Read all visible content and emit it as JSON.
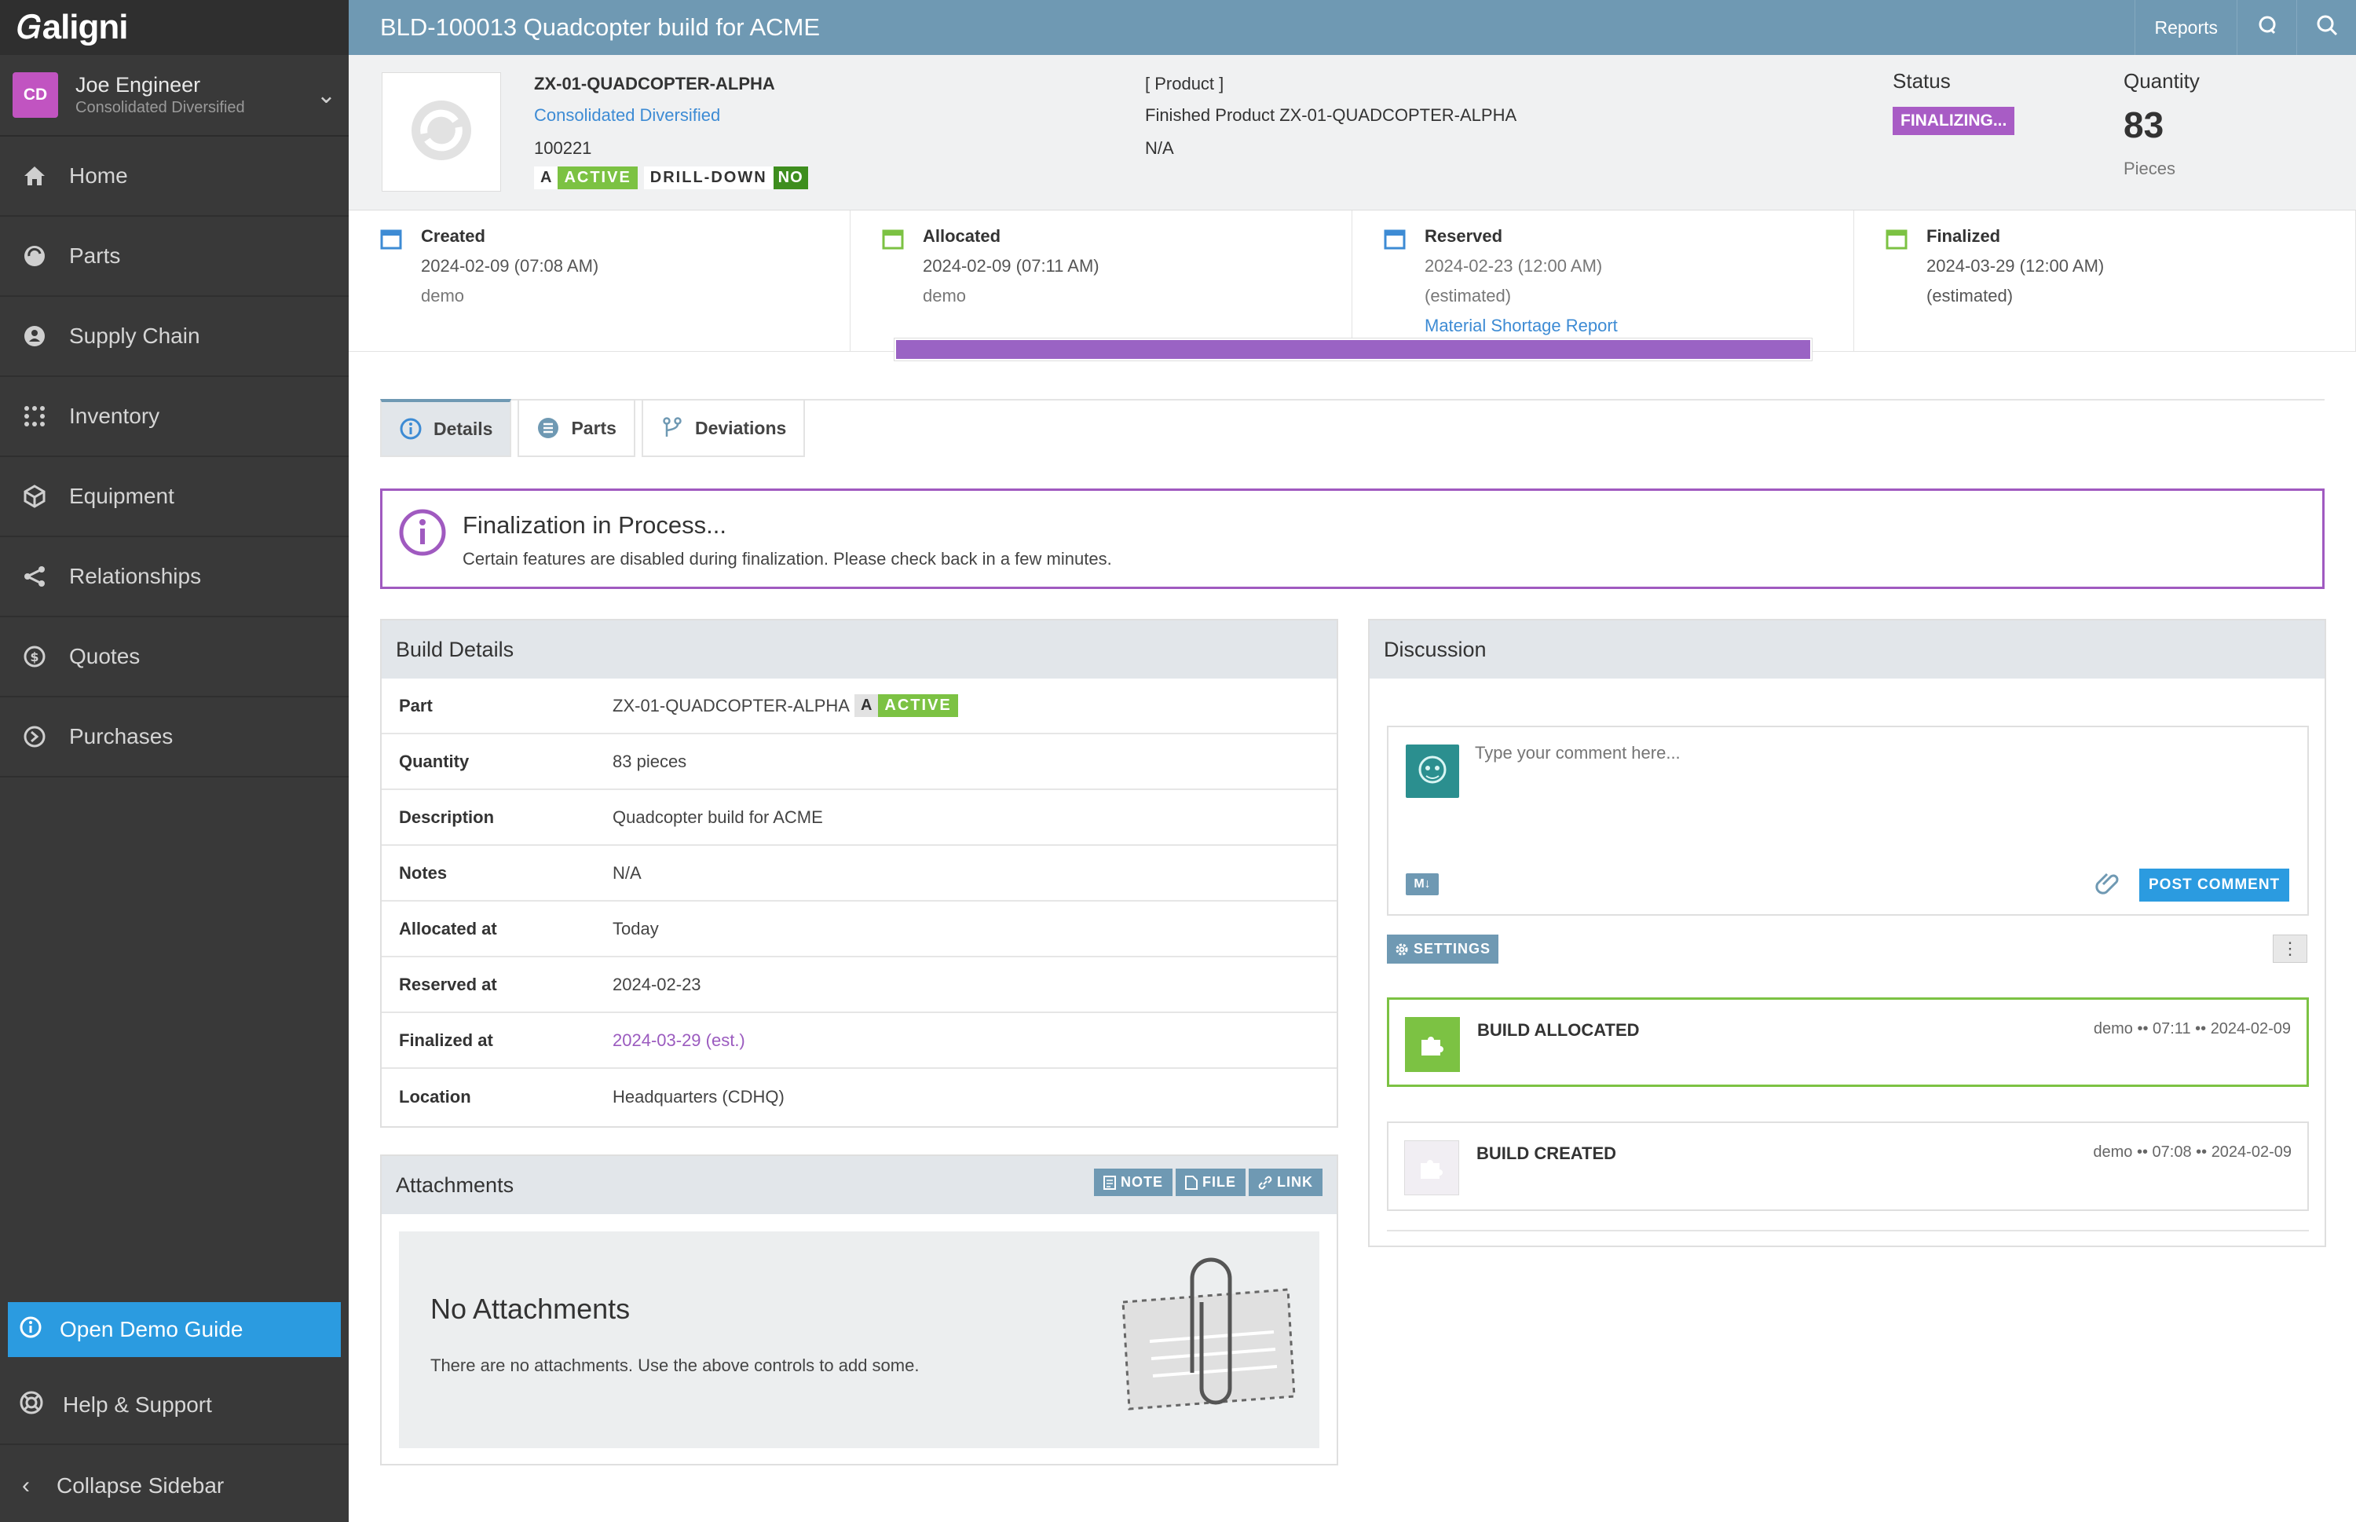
{
  "app": {
    "logo": "aligni"
  },
  "user": {
    "initials": "CD",
    "name": "Joe Engineer",
    "org": "Consolidated Diversified"
  },
  "nav": [
    {
      "label": "Home",
      "icon": "home-icon"
    },
    {
      "label": "Parts",
      "icon": "parts-icon"
    },
    {
      "label": "Supply Chain",
      "icon": "supply-chain-icon"
    },
    {
      "label": "Inventory",
      "icon": "inventory-icon"
    },
    {
      "label": "Equipment",
      "icon": "equipment-icon"
    },
    {
      "label": "Relationships",
      "icon": "relationships-icon"
    },
    {
      "label": "Quotes",
      "icon": "quotes-icon"
    },
    {
      "label": "Purchases",
      "icon": "purchases-icon"
    }
  ],
  "sidebar_bottom": {
    "demo_guide": "Open Demo Guide",
    "help": "Help & Support",
    "collapse": "Collapse Sidebar"
  },
  "header": {
    "title": "BLD-100013 Quadcopter build for ACME",
    "reports": "Reports"
  },
  "summary": {
    "part_number": "ZX-01-QUADCOPTER-ALPHA",
    "company": "Consolidated Diversified",
    "number": "100221",
    "rev": "A",
    "state": "ACTIVE",
    "drilldown_label": "DRILL-DOWN",
    "drilldown_value": "NO",
    "product_type": "[ Product ]",
    "product_desc": "Finished Product ZX-01-QUADCOPTER-ALPHA",
    "product_na": "N/A",
    "status_label": "Status",
    "status_value": "FINALIZING...",
    "quantity_label": "Quantity",
    "quantity_value": "83",
    "quantity_unit": "Pieces"
  },
  "timeline": [
    {
      "title": "Created",
      "line1": "2024-02-09 (07:08 AM)",
      "line2": "demo",
      "link": ""
    },
    {
      "title": "Allocated",
      "line1": "2024-02-09 (07:11 AM)",
      "line2": "demo",
      "link": ""
    },
    {
      "title": "Reserved",
      "line1": "2024-02-23 (12:00 AM)",
      "line2": "(estimated)",
      "link": "Material Shortage Report"
    },
    {
      "title": "Finalized",
      "line1": "2024-03-29 (12:00 AM)",
      "line2": "(estimated)",
      "link": ""
    }
  ],
  "progress_fraction": 1.0,
  "tabs": [
    "Details",
    "Parts",
    "Deviations"
  ],
  "alert": {
    "title": "Finalization in Process...",
    "message": "Certain features are disabled during finalization. Please check back in a few minutes."
  },
  "build_details": {
    "heading": "Build Details",
    "rows": [
      {
        "label": "Part",
        "value": "ZX-01-QUADCOPTER-ALPHA"
      },
      {
        "label": "Quantity",
        "value": "83 pieces"
      },
      {
        "label": "Description",
        "value": "Quadcopter build for ACME"
      },
      {
        "label": "Notes",
        "value": "N/A"
      },
      {
        "label": "Allocated at",
        "value": "Today"
      },
      {
        "label": "Reserved at",
        "value": "2024-02-23"
      },
      {
        "label": "Finalized at",
        "value": "2024-03-29 (est.)"
      },
      {
        "label": "Location",
        "value": "Headquarters (CDHQ)"
      }
    ],
    "part_rev": "A",
    "part_state": "ACTIVE"
  },
  "attachments": {
    "heading": "Attachments",
    "buttons": [
      "NOTE",
      "FILE",
      "LINK"
    ],
    "empty_title": "No Attachments",
    "empty_msg": "There are no attachments. Use the above controls to add some."
  },
  "discussion": {
    "heading": "Discussion",
    "placeholder": "Type your comment here...",
    "markdown_badge": "M↓",
    "post": "POST COMMENT",
    "settings": "SETTINGS",
    "events": [
      {
        "title": "BUILD ALLOCATED",
        "meta": "demo •• 07:11 •• 2024-02-09"
      },
      {
        "title": "BUILD CREATED",
        "meta": "demo •• 07:08 •• 2024-02-09"
      }
    ]
  },
  "colors": {
    "header": "#6f99b3",
    "sidebar": "#393939",
    "accent_purple": "#a05ac0",
    "active_green": "#7cc243",
    "link_blue": "#3d8bd4"
  }
}
